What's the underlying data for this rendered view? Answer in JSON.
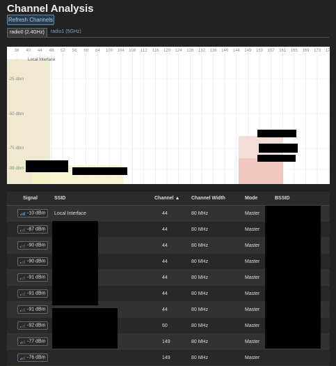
{
  "page": {
    "title": "Channel Analysis",
    "refresh_label": "Refresh Channels",
    "tabs": [
      {
        "label": "radio0 (2.4GHz)",
        "active": true
      },
      {
        "label": "radio1 (5GHz)",
        "active": false
      }
    ]
  },
  "chart": {
    "channel_ticks": [
      "36",
      "40",
      "44",
      "48",
      "52",
      "56",
      "60",
      "64",
      "100",
      "104",
      "108",
      "112",
      "116",
      "120",
      "124",
      "128",
      "132",
      "136",
      "140",
      "144",
      "149",
      "153",
      "157",
      "161",
      "165",
      "169",
      "173",
      "177"
    ],
    "dbm_labels": [
      "-25 dbm",
      "-50 dbm",
      "-75 dbm",
      "-99 dbm"
    ],
    "local_interface_label": "Local Interface",
    "colors": {
      "local": "#efe9cf",
      "low_yellow": "#f6f3c4",
      "channel_149": "#efc7bf",
      "channel_149_light": "#f3ddd7",
      "grid": "#e0e0e0",
      "axis_text": "#888888"
    }
  },
  "table": {
    "headers": {
      "signal": "Signal",
      "ssid": "SSID",
      "channel": "Channel ▲",
      "width": "Channel Width",
      "mode": "Mode",
      "bssid": "BSSID"
    },
    "rows": [
      {
        "signal": "-10 dBm",
        "ssid": "Local Interface",
        "channel": "44",
        "width": "80 MHz",
        "mode": "Master",
        "bars": 4
      },
      {
        "signal": "-87 dBm",
        "ssid": "",
        "channel": "44",
        "width": "80 MHz",
        "mode": "Master",
        "bars": 1
      },
      {
        "signal": "-90 dBm",
        "ssid": "",
        "channel": "44",
        "width": "80 MHz",
        "mode": "Master",
        "bars": 1
      },
      {
        "signal": "-90 dBm",
        "ssid": "",
        "channel": "44",
        "width": "80 MHz",
        "mode": "Master",
        "bars": 1
      },
      {
        "signal": "-91 dBm",
        "ssid": "",
        "channel": "44",
        "width": "80 MHz",
        "mode": "Master",
        "bars": 1
      },
      {
        "signal": "-91 dBm",
        "ssid": "",
        "channel": "44",
        "width": "80 MHz",
        "mode": "Master",
        "bars": 1
      },
      {
        "signal": "-91 dBm",
        "ssid": "",
        "channel": "44",
        "width": "80 MHz",
        "mode": "Master",
        "bars": 1
      },
      {
        "signal": "-92 dBm",
        "ssid": "",
        "channel": "60",
        "width": "80 MHz",
        "mode": "Master",
        "bars": 1
      },
      {
        "signal": "-77 dBm",
        "ssid": "",
        "channel": "149",
        "width": "80 MHz",
        "mode": "Master",
        "bars": 2
      },
      {
        "signal": "-76 dBm",
        "ssid": "",
        "channel": "149",
        "width": "80 MHz",
        "mode": "Master",
        "bars": 2
      }
    ]
  }
}
